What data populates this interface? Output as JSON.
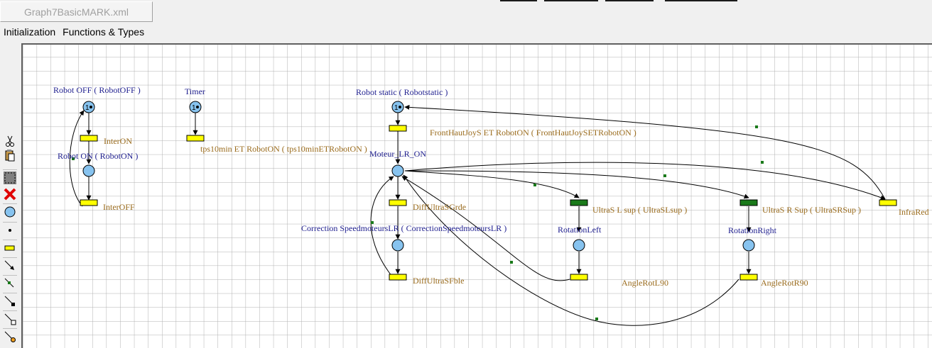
{
  "window": {
    "tab_title": "Graph7BasicMARK.xml"
  },
  "menu": {
    "items": [
      "Initialization",
      "Functions & Types"
    ]
  },
  "toolbar": {
    "tools": [
      "scissors-icon",
      "paste-icon",
      "select-icon",
      "delete-icon",
      "place-tool-icon",
      "token-tool-icon",
      "transition-tool-icon",
      "arc-tool-icon",
      "inhibitor-arc-tool-icon",
      "test-arc-tool-icon",
      "reset-arc-tool-icon",
      "read-arc-tool-icon"
    ]
  },
  "colors": {
    "place_fill": "#87c3ef",
    "transition_fill": "#ffff00",
    "transition_active": "#1a7a1a",
    "place_label": "#1f1f8f",
    "transition_label": "#9a6b1c",
    "grid": "#b0b0b0"
  },
  "net": {
    "places": [
      {
        "id": "robotoff",
        "label": "Robot OFF ( RobotOFF )",
        "tokens": "1"
      },
      {
        "id": "roboton",
        "label": "Robot ON ( RobotON )",
        "tokens": ""
      },
      {
        "id": "timer",
        "label": "Timer",
        "tokens": "1"
      },
      {
        "id": "robotstatic",
        "label": "Robot static ( Robotstatic )",
        "tokens": "1"
      },
      {
        "id": "moteur",
        "label": "Moteur_LR_ON",
        "tokens": ""
      },
      {
        "id": "correction",
        "label": "Correction SpeedmoteursLR ( CorrectionSpeedmoteursLR )",
        "tokens": ""
      },
      {
        "id": "rotleft",
        "label": "RotationLeft",
        "tokens": ""
      },
      {
        "id": "rotright",
        "label": "RotationRight",
        "tokens": ""
      }
    ],
    "transitions": [
      {
        "id": "interon",
        "label": "InterON",
        "active": false
      },
      {
        "id": "interoff",
        "label": "InterOFF",
        "active": false
      },
      {
        "id": "tps10",
        "label": "tps10min ET RobotON ( tps10minETRobotON )",
        "active": false
      },
      {
        "id": "fronthaut",
        "label": "FrontHautJoyS ET RobotON ( FrontHautJoySETRobotON )",
        "active": false
      },
      {
        "id": "diffgrde",
        "label": "DiffUltraSGrde",
        "active": false
      },
      {
        "id": "difffble",
        "label": "DiffUltraSFble",
        "active": false
      },
      {
        "id": "ultrasl",
        "label": "UltraS L sup ( UltraSLsup )",
        "active": true
      },
      {
        "id": "ultrasr",
        "label": "UltraS R Sup ( UltraSRSup )",
        "active": true
      },
      {
        "id": "anglel",
        "label": "AngleRotL90",
        "active": false
      },
      {
        "id": "angler",
        "label": "AngleRotR90",
        "active": false
      },
      {
        "id": "infrared",
        "label": "InfraRed",
        "active": false
      }
    ]
  }
}
